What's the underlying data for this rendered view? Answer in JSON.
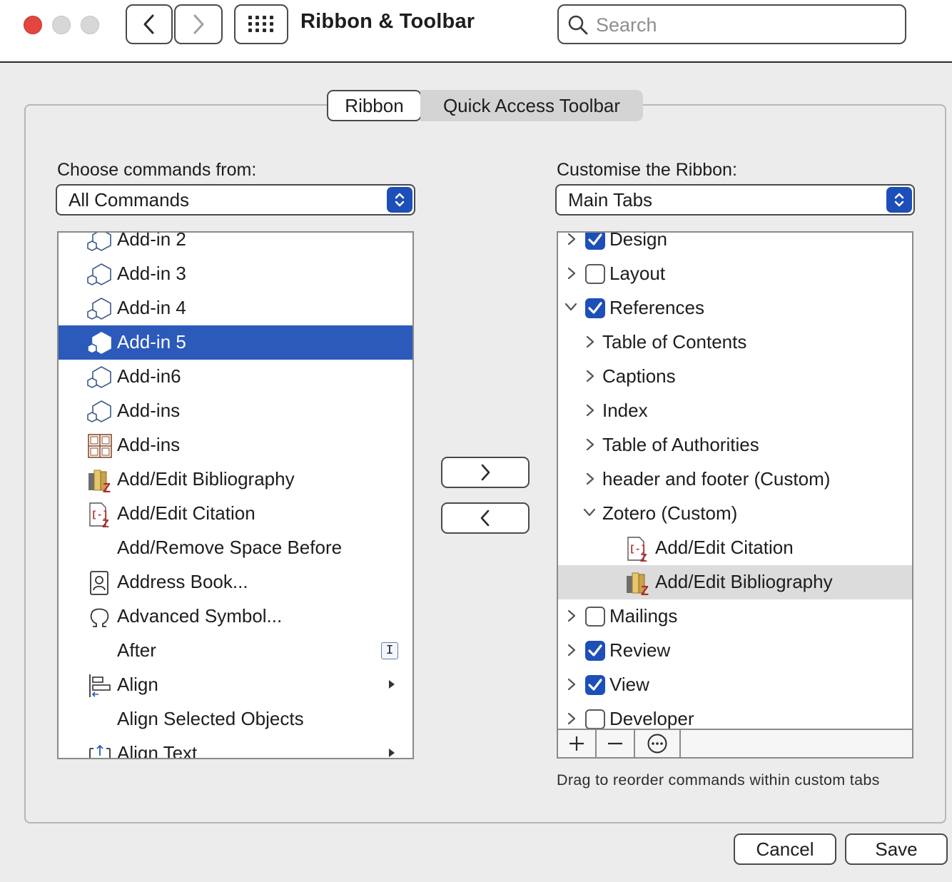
{
  "window": {
    "title": "Ribbon & Toolbar"
  },
  "search": {
    "placeholder": "Search",
    "value": ""
  },
  "tabs": [
    {
      "label": "Ribbon",
      "selected": true
    },
    {
      "label": "Quick Access Toolbar",
      "selected": false
    }
  ],
  "left": {
    "label": "Choose commands from:",
    "dropdown": "All Commands",
    "items": [
      {
        "label": "Add-in 2",
        "icon": "hexagon-outline-icon"
      },
      {
        "label": "Add-in 3",
        "icon": "hexagon-outline-icon"
      },
      {
        "label": "Add-in 4",
        "icon": "hexagon-outline-icon"
      },
      {
        "label": "Add-in 5",
        "icon": "hexagon-filled-icon",
        "selected": true
      },
      {
        "label": "Add-in6",
        "icon": "hexagon-outline-icon"
      },
      {
        "label": "Add-ins",
        "icon": "hexagon-outline-icon"
      },
      {
        "label": "Add-ins",
        "icon": "grid-addins-icon"
      },
      {
        "label": "Add/Edit Bibliography",
        "icon": "zotero-bibliography-icon"
      },
      {
        "label": "Add/Edit Citation",
        "icon": "zotero-citation-icon"
      },
      {
        "label": "Add/Remove Space Before",
        "icon": ""
      },
      {
        "label": "Address Book...",
        "icon": "address-book-icon"
      },
      {
        "label": "Advanced Symbol...",
        "icon": "omega-icon"
      },
      {
        "label": "After",
        "icon": "",
        "badge": "I"
      },
      {
        "label": "Align",
        "icon": "align-icon",
        "submenu": true
      },
      {
        "label": "Align Selected Objects",
        "icon": ""
      },
      {
        "label": "Align Text",
        "icon": "align-text-icon",
        "submenu": true
      }
    ]
  },
  "right": {
    "label": "Customise the Ribbon:",
    "dropdown": "Main Tabs",
    "items": [
      {
        "label": "Design",
        "level": 0,
        "checked": true,
        "expanded": false
      },
      {
        "label": "Layout",
        "level": 0,
        "checked": false,
        "expanded": false
      },
      {
        "label": "References",
        "level": 0,
        "checked": true,
        "expanded": true
      },
      {
        "label": "Table of Contents",
        "level": 1,
        "expanded": false
      },
      {
        "label": "Captions",
        "level": 1,
        "expanded": false
      },
      {
        "label": "Index",
        "level": 1,
        "expanded": false
      },
      {
        "label": "Table of Authorities",
        "level": 1,
        "expanded": false
      },
      {
        "label": "header and footer (Custom)",
        "level": 1,
        "expanded": false
      },
      {
        "label": "Zotero (Custom)",
        "level": 1,
        "expanded": true
      },
      {
        "label": "Add/Edit Citation",
        "level": 2,
        "icon": "zotero-citation-icon"
      },
      {
        "label": "Add/Edit Bibliography",
        "level": 2,
        "icon": "zotero-bibliography-icon",
        "highlighted": true
      },
      {
        "label": "Mailings",
        "level": 0,
        "checked": false,
        "expanded": false
      },
      {
        "label": "Review",
        "level": 0,
        "checked": true,
        "expanded": false
      },
      {
        "label": "View",
        "level": 0,
        "checked": true,
        "expanded": false
      },
      {
        "label": "Developer",
        "level": 0,
        "checked": false,
        "expanded": false
      }
    ]
  },
  "hint": "Drag to reorder commands within custom tabs",
  "buttons": {
    "cancel": "Cancel",
    "save": "Save"
  },
  "colors": {
    "accent": "#1d4fb8",
    "selection": "#2b5aba",
    "close": "#e2463f"
  }
}
